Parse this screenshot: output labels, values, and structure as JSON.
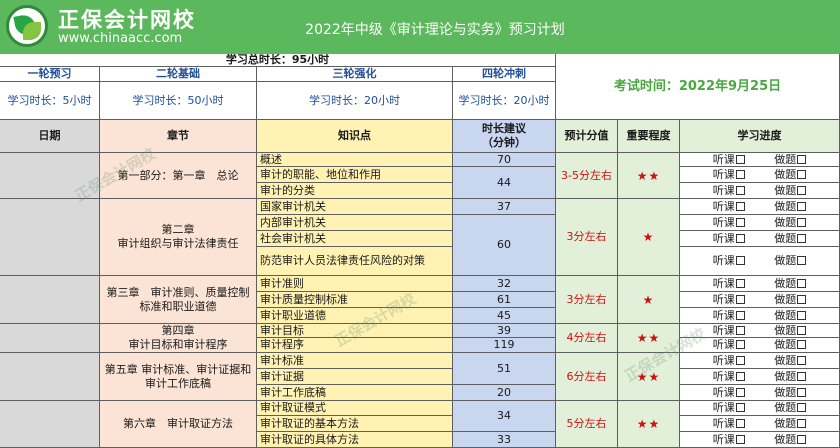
{
  "header": {
    "brand_name": "正保会计网校",
    "brand_url": "www.chinaacc.com",
    "title": "2022年中级《审计理论与实务》预习计划"
  },
  "summary": {
    "total_time": "学习总时长：95小时",
    "exam_time": "考试时间：2022年9月25日",
    "phases": [
      {
        "name": "一轮预习",
        "time": "学习时长：5小时"
      },
      {
        "name": "二轮基础",
        "time": "学习时长：50小时"
      },
      {
        "name": "三轮强化",
        "time": "学习时长：20小时"
      },
      {
        "name": "四轮冲刺",
        "time": "学习时长：20小时"
      }
    ]
  },
  "columns": {
    "date": "日期",
    "chapter": "章节",
    "point": "知识点",
    "time_line1": "时长建议",
    "time_line2": "（分钟）",
    "score": "预计分值",
    "importance": "重要程度",
    "progress": "学习进度"
  },
  "progress_labels": {
    "listen": "听课",
    "practice": "做题"
  },
  "chapters": [
    {
      "name_line1": "第一部分：第一章　总论",
      "name_line2": "",
      "score": "3-5分左右",
      "stars": "★★"
    },
    {
      "name_line1": "第二章",
      "name_line2": "审计组织与审计法律责任",
      "score": "3分左右",
      "stars": "★"
    },
    {
      "name_line1": "第三章　审计准则、质量控制",
      "name_line2": "标准和职业道德",
      "score": "3分左右",
      "stars": "★"
    },
    {
      "name_line1": "第四章",
      "name_line2": "审计目标和审计程序",
      "score": "4分左右",
      "stars": "★★"
    },
    {
      "name_line1": "第五章 审计标准、审计证据和",
      "name_line2": "审计工作底稿",
      "score": "6分左右",
      "stars": "★★"
    },
    {
      "name_line1": "第六章　审计取证方法",
      "name_line2": "",
      "score": "5分左右",
      "stars": "★★"
    }
  ],
  "points": [
    "概述",
    "审计的职能、地位和作用",
    "审计的分类",
    "国家审计机关",
    "内部审计机关",
    "社会审计机关",
    "防范审计人员法律责任风险的对策",
    "审计准则",
    "审计质量控制标准",
    "审计职业道德",
    "审计目标",
    "审计程序",
    "审计标准",
    "审计证据",
    "审计工作底稿",
    "审计取证模式",
    "审计取证的基本方法",
    "审计取证的具体方法"
  ],
  "times": [
    "70",
    "44",
    "37",
    "60",
    "32",
    "61",
    "45",
    "39",
    "119",
    "51",
    "20",
    "34",
    "33"
  ],
  "watermark": "正保会计网校"
}
